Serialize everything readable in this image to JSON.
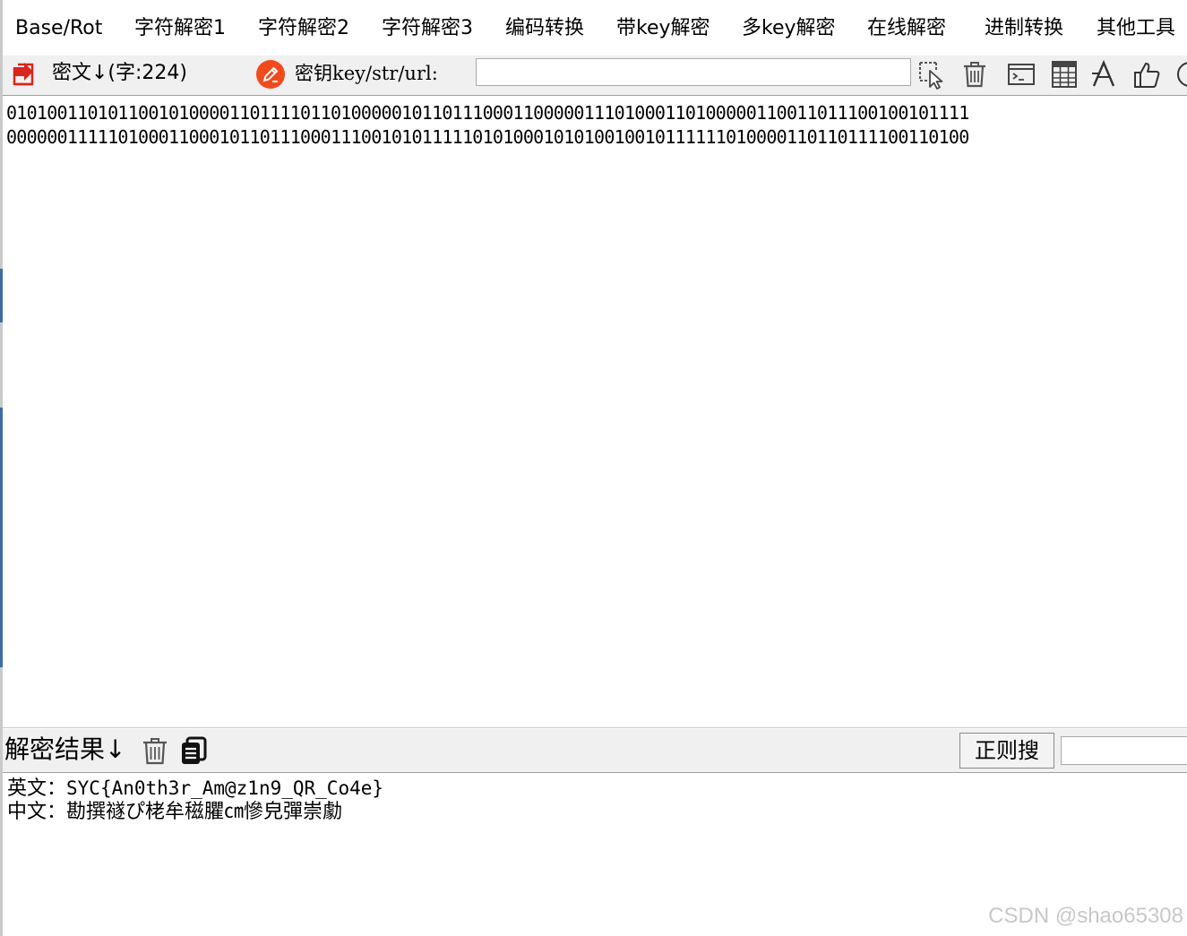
{
  "menu": {
    "items": [
      "Base/Rot",
      "字符解密1",
      "字符解密2",
      "字符解密3",
      "编码转换",
      "带key解密",
      "多key解密",
      "在线解密",
      "进制转换",
      "其他工具"
    ]
  },
  "toolbar": {
    "cipher_label": "密文↓(字:224)",
    "key_label": "密钥key/str/url:",
    "key_value": "",
    "icons": [
      "import-icon",
      "key-edit-icon",
      "select-cursor-icon",
      "trash-icon",
      "terminal-icon",
      "calculator-icon",
      "font-icon",
      "thumbs-up-icon"
    ]
  },
  "cipher": {
    "lines": [
      "01010011010110010100001101111011010000010110111000110000011101000110100000110011011100100101111",
      "00000011111010001100010110111000111001010111110101000101010010010111111010000110110111100110100"
    ]
  },
  "result": {
    "label": "解密结果↓",
    "regex_button": "正则搜",
    "regex_value": "",
    "english_label": "英文：",
    "english_value": "SYC{An0th3r_Am@z1n9_QR_Co4e}",
    "chinese_label": "中文：",
    "chinese_value": "勘撰禭ぴ栳牟稵臞㎝慘皃彈崇勮"
  },
  "watermark": "CSDN @shao65308",
  "colors": {
    "toolbar_bg": "#f0f0f0",
    "import_icon": "#d9261c",
    "key_icon": "#f24a1d"
  }
}
